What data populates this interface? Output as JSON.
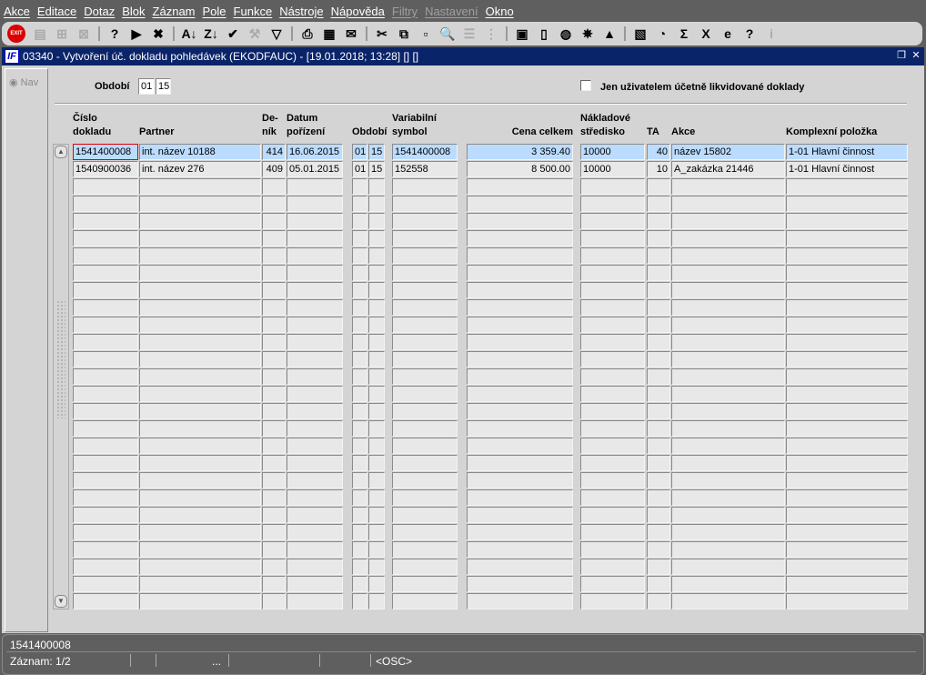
{
  "menu": [
    {
      "label": "Akce",
      "enabled": true
    },
    {
      "label": "Editace",
      "enabled": true
    },
    {
      "label": "Dotaz",
      "enabled": true
    },
    {
      "label": "Blok",
      "enabled": true
    },
    {
      "label": "Záznam",
      "enabled": true
    },
    {
      "label": "Pole",
      "enabled": true
    },
    {
      "label": "Funkce",
      "enabled": true
    },
    {
      "label": "Nástroje",
      "enabled": true
    },
    {
      "label": "Nápověda",
      "enabled": true
    },
    {
      "label": "Filtry",
      "enabled": false
    },
    {
      "label": "Nastavení",
      "enabled": false
    },
    {
      "label": "Okno",
      "enabled": true
    }
  ],
  "toolbar": {
    "exit_label": "EXIT",
    "icons": [
      "save",
      "insert-record",
      "delete-record",
      "|",
      "query-enter",
      "query-execute",
      "query-cancel",
      "|",
      "sort-ascending",
      "sort-descending",
      "confirm",
      "tools",
      "filter",
      "|",
      "print",
      "print-setup",
      "send-mail",
      "|",
      "cut",
      "copy",
      "paste",
      "zoom",
      "list",
      "tree",
      "|",
      "calculator",
      "document",
      "globe",
      "wheel",
      "warning",
      "|",
      "chart",
      "clock",
      "sum",
      "excel",
      "internet-explorer",
      "help",
      "info"
    ]
  },
  "window": {
    "title": "03340 - Vytvoření úč. dokladu pohledávek (EKODFAUC) - [19.01.2018; 13:28]  [] []",
    "logo": "IF"
  },
  "nav": {
    "label": "Nav"
  },
  "filter": {
    "obdobi_label": "Období",
    "obdobi_month": "01",
    "obdobi_year": "15",
    "checkbox_label": "Jen uživatelem účetně likvidované doklady",
    "checkbox_checked": false
  },
  "columns": {
    "cislo": "Číslo\ndokladu",
    "partner": "Partner",
    "denik": "De-\nník",
    "datum": "Datum\npořízení",
    "obdobi": "Období",
    "var": "Variabilní\nsymbol",
    "cena": "Cena celkem",
    "naklad": "Nákladové\nstředisko",
    "ta": "TA",
    "akce": "Akce",
    "kompl": "Komplexní položka"
  },
  "rows": [
    [
      "1541400008",
      "int. název 10188",
      "414",
      "16.06.2015",
      "01",
      "15",
      "1541400008",
      "3 359.40",
      "10000",
      "40",
      "název 15802",
      "1-01 Hlavní činnost"
    ],
    [
      "1540900036",
      "int. název 276",
      "409",
      "05.01.2015",
      "01",
      "15",
      "152558",
      "8 500.00",
      "10000",
      "10",
      "A_zakázka 21446",
      "1-01 Hlavní činnost"
    ]
  ],
  "empty_rows": 25,
  "status": {
    "field_value": "1541400008",
    "record": "Záznam: 1/2",
    "dots": "...",
    "mode": "<OSC>"
  },
  "colors": {
    "selected_row": "#bcdcff",
    "titlebar": "#0a246a",
    "current_field_border": "#e00000"
  }
}
